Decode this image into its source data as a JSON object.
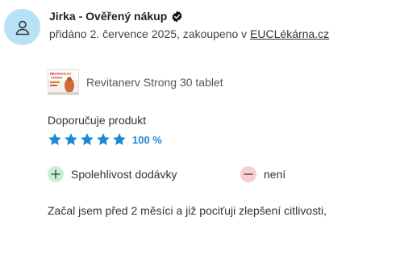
{
  "review": {
    "author": "Jirka - Ověřený nákup",
    "meta_prefix": "přidáno 2. července 2025, zakoupeno v ",
    "shop_link": "EUCLékárna.cz",
    "product_name": "Revitanerv Strong 30 tablet",
    "thumb_text": "REVITANERV STRONG",
    "recommend_label": "Doporučuje produkt",
    "stars": 5,
    "max_stars": 5,
    "recommend_percent": "100 %",
    "pro_label": "Spolehlivost dodávky",
    "con_label": "není",
    "text": "Začal jsem před 2 měsíci a již pociťuji zlepšení citlivosti,"
  },
  "colors": {
    "avatar_bg": "#b7e2f5",
    "star": "#1e8ad6",
    "pro_circle": "#c6f0d6",
    "con_circle": "#f8cdd3"
  },
  "icons": {
    "avatar": "user-icon",
    "verified": "verified-check-icon",
    "star": "star-icon",
    "plus": "plus-icon",
    "minus": "minus-icon"
  }
}
